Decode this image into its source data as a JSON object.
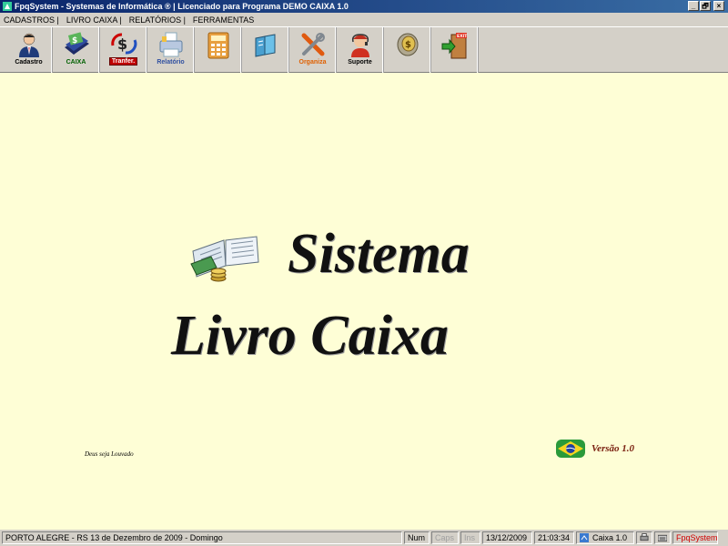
{
  "window": {
    "title": "FpqSystem - Systemas de Informática ® | Licenciado para Programa DEMO CAIXA 1.0",
    "controls": [
      "_",
      "🗗",
      "×"
    ]
  },
  "menu": {
    "items": [
      "CADASTROS |",
      "LIVRO CAIXA |",
      "RELATÓRIOS |",
      "FERRAMENTAS"
    ]
  },
  "toolbar": {
    "buttons": [
      {
        "label": "Cadastro",
        "icon": "user-icon"
      },
      {
        "label": "CAIXA",
        "icon": "cash-book-icon"
      },
      {
        "label": "Tranfer.",
        "icon": "transfer-icon"
      },
      {
        "label": "Relatório",
        "icon": "printer-icon"
      },
      {
        "label": "",
        "icon": "calculator-icon"
      },
      {
        "label": "",
        "icon": "book-icon"
      },
      {
        "label": "Organiza",
        "icon": "tools-icon"
      },
      {
        "label": "Suporte",
        "icon": "support-icon"
      },
      {
        "label": "",
        "icon": "coin-icon"
      },
      {
        "label": "",
        "icon": "exit-icon"
      }
    ]
  },
  "main": {
    "title_line1": "Sistema",
    "title_line2": "Livro Caixa",
    "signature": "Deus seja Louvado",
    "version": "Versão 1.0"
  },
  "status": {
    "location": "PORTO ALEGRE - RS 13 de Dezembro de 2009 - Domingo",
    "num": "Num",
    "caps": "Caps",
    "ins": "Ins",
    "date": "13/12/2009",
    "time": "21:03:34",
    "app": "Caixa 1.0",
    "brand": "FpqSystem"
  },
  "colors": {
    "background": "#fefed6",
    "titlebar": "#0a246a",
    "brand_red": "#d00000"
  }
}
